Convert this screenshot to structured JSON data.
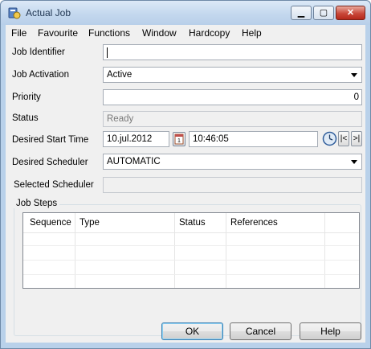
{
  "window": {
    "title": "Actual Job"
  },
  "menu": [
    "File",
    "Favourite",
    "Functions",
    "Window",
    "Hardcopy",
    "Help"
  ],
  "form": {
    "job_identifier": {
      "label": "Job Identifier",
      "value": ""
    },
    "job_activation": {
      "label": "Job Activation",
      "value": "Active"
    },
    "priority": {
      "label": "Priority",
      "value": "0"
    },
    "status": {
      "label": "Status",
      "value": "Ready"
    },
    "desired_start_time": {
      "label": "Desired Start Time",
      "date": "10.jul.2012",
      "time": "10:46:05"
    },
    "desired_scheduler": {
      "label": "Desired Scheduler",
      "value": "AUTOMATIC"
    },
    "selected_scheduler": {
      "label": "Selected Scheduler",
      "value": ""
    }
  },
  "job_steps": {
    "title": "Job Steps",
    "columns": [
      "Sequence",
      "Type",
      "Status",
      "References"
    ],
    "rows": []
  },
  "buttons": {
    "ok": "OK",
    "cancel": "Cancel",
    "help": "Help"
  },
  "time_nav": {
    "first": "|<",
    "last": ">|"
  }
}
